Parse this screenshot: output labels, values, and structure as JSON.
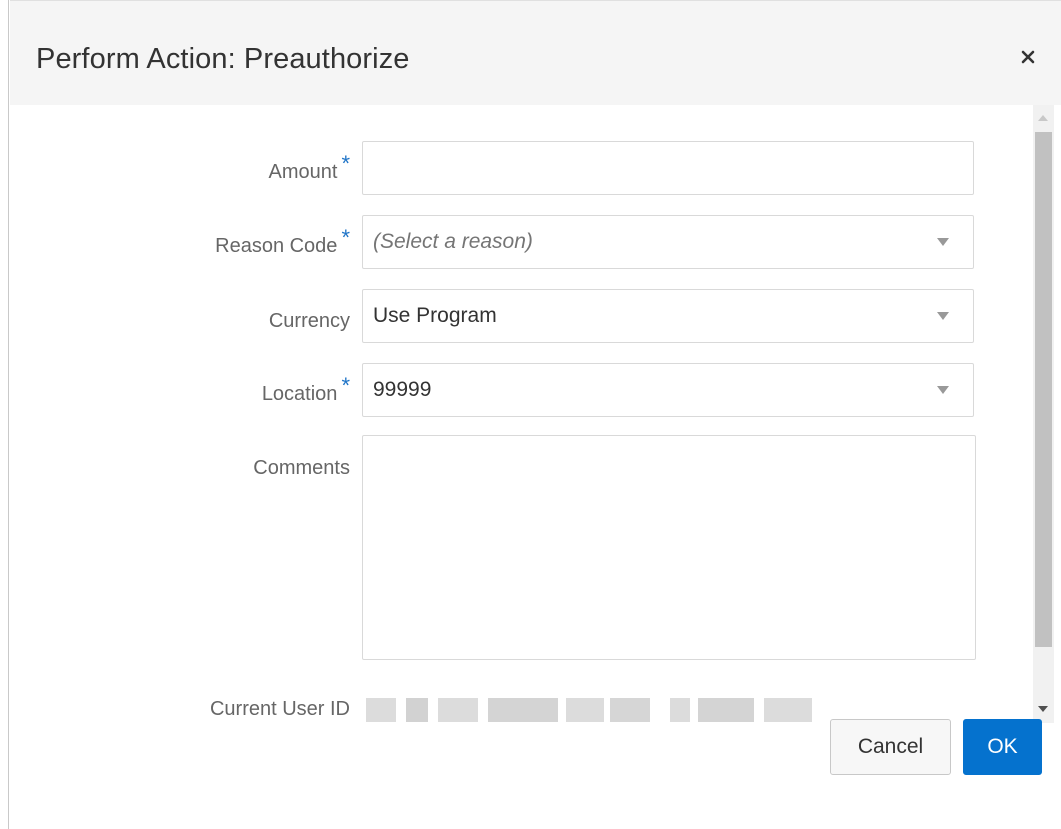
{
  "dialog": {
    "title": "Perform Action: Preauthorize",
    "close_icon": "close-icon"
  },
  "form": {
    "amount": {
      "label": "Amount",
      "required_mark": "*",
      "value": ""
    },
    "reason_code": {
      "label": "Reason Code",
      "required_mark": "*",
      "value": "(Select a reason)"
    },
    "currency": {
      "label": "Currency",
      "value": "Use Program"
    },
    "location": {
      "label": "Location",
      "required_mark": "*",
      "value": "99999"
    },
    "comments": {
      "label": "Comments",
      "value": ""
    },
    "current_user_id": {
      "label": "Current User ID"
    }
  },
  "buttons": {
    "cancel": "Cancel",
    "ok": "OK"
  },
  "colors": {
    "accent": "#0572ce",
    "required": "#1f74c7",
    "header_bg": "#f5f5f5"
  }
}
